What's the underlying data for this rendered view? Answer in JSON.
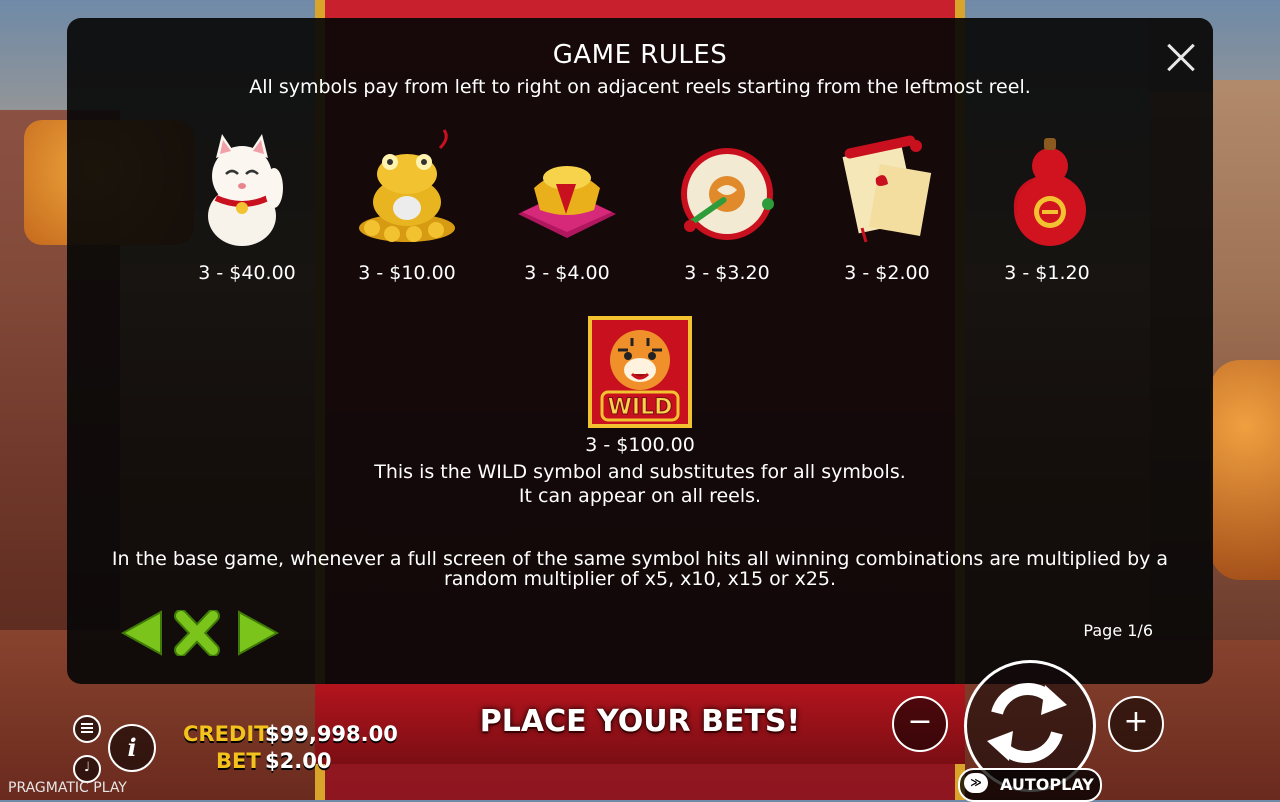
{
  "modal": {
    "title": "GAME RULES",
    "subtitle": "All symbols pay from left to right on adjacent reels starting from the leftmost reel.",
    "symbols": [
      {
        "name": "lucky-cat",
        "pay": "3 - $40.00"
      },
      {
        "name": "golden-toad",
        "pay": "3 - $10.00"
      },
      {
        "name": "gold-ingot",
        "pay": "3 - $4.00"
      },
      {
        "name": "drum",
        "pay": "3 - $3.20"
      },
      {
        "name": "scroll",
        "pay": "3 - $2.00"
      },
      {
        "name": "red-gourd",
        "pay": "3 - $1.20"
      }
    ],
    "wild": {
      "label": "WILD",
      "pay": "3 - $100.00",
      "desc_line1": "This is the WILD symbol and substitutes for all symbols.",
      "desc_line2": "It can appear on all reels."
    },
    "base_text": "In the base game, whenever a full screen of the same symbol hits all winning combinations are multiplied by a random multiplier of x5, x10, x15 or x25.",
    "page_indicator": "Page 1/6"
  },
  "bottom": {
    "place_bets": "PLACE YOUR BETS!",
    "credit_label": "CREDIT",
    "credit_value": "$99,998.00",
    "bet_label": "BET",
    "bet_value": "$2.00",
    "autoplay_label": "AUTOPLAY",
    "brand": "PRAGMATIC PLAY",
    "info_label": "i"
  },
  "colors": {
    "accent_gold": "#f4c21c",
    "nav_green": "#7bc41c",
    "modal_bg": "#080808"
  }
}
